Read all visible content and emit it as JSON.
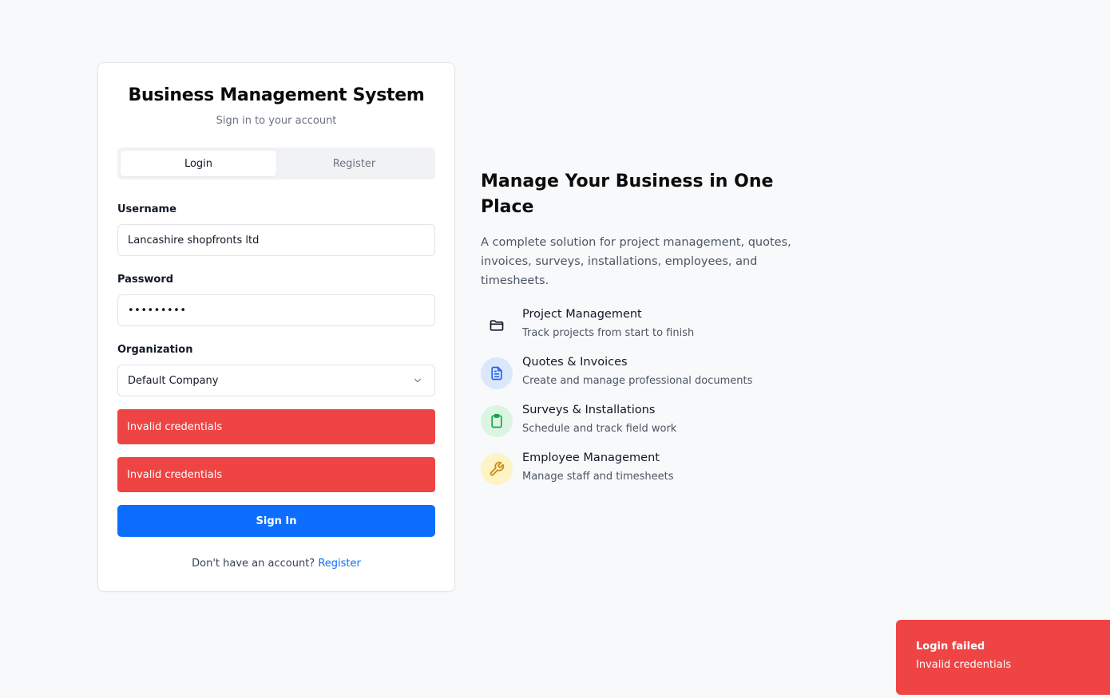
{
  "card": {
    "title": "Business Management System",
    "subtitle": "Sign in to your account",
    "tabs": [
      {
        "label": "Login",
        "active": true
      },
      {
        "label": "Register",
        "active": false
      }
    ],
    "username": {
      "label": "Username",
      "value": "Lancashire shopfronts ltd"
    },
    "password": {
      "label": "Password",
      "value": "•••••••••"
    },
    "organization": {
      "label": "Organization",
      "value": "Default Company"
    },
    "alerts": [
      "Invalid credentials",
      "Invalid credentials"
    ],
    "signin_label": "Sign In",
    "footer": {
      "text": "Don't have an account? ",
      "link": "Register"
    }
  },
  "hero": {
    "title": "Manage Your Business in One Place",
    "description": "A complete solution for project management, quotes, invoices, surveys, installations, employees, and timesheets."
  },
  "features": [
    {
      "icon": "folder-icon",
      "title": "Project Management",
      "desc": "Track projects from start to finish",
      "bg": "transparent",
      "color": "#111827"
    },
    {
      "icon": "document-icon",
      "title": "Quotes & Invoices",
      "desc": "Create and manage professional documents",
      "bg": "#dbe7fb",
      "color": "#2563eb"
    },
    {
      "icon": "clipboard-icon",
      "title": "Surveys & Installations",
      "desc": "Schedule and track field work",
      "bg": "#dcf5e3",
      "color": "#16a34a"
    },
    {
      "icon": "wrench-icon",
      "title": "Employee Management",
      "desc": "Manage staff and timesheets",
      "bg": "#fdf3c4",
      "color": "#ca8a04"
    }
  ],
  "toast": {
    "title": "Login failed",
    "message": "Invalid credentials"
  },
  "colors": {
    "primary": "#0d6efd",
    "danger": "#ef4444",
    "background": "#f8f9fb"
  }
}
